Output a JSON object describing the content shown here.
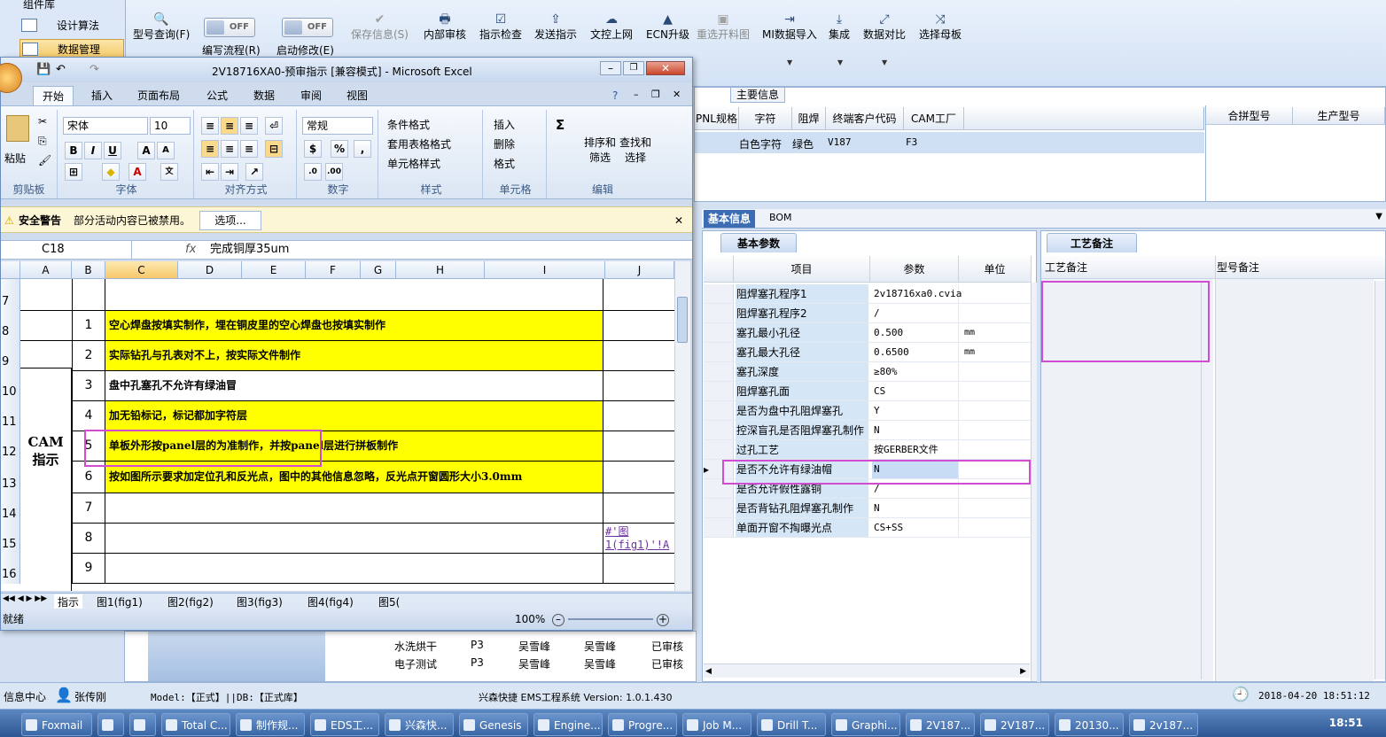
{
  "left_nav": {
    "top_label": "组件库",
    "items": [
      {
        "label": "设计算法"
      },
      {
        "label": "数据管理"
      }
    ]
  },
  "toolbar": {
    "tabs_hint": "EMS工程系统",
    "buttons": [
      {
        "label": "型号查询(F)",
        "glyph": "🔍"
      },
      {
        "label": "编写流程(R)",
        "toggle": "OFF"
      },
      {
        "label": "启动修改(E)",
        "toggle": "OFF"
      },
      {
        "label": "保存信息(S)",
        "glyph": "✔"
      },
      {
        "label": "内部审核",
        "glyph": "🖶"
      },
      {
        "label": "指示检查",
        "glyph": "☑"
      },
      {
        "label": "发送指示",
        "glyph": "⇪"
      },
      {
        "label": "文控上网",
        "glyph": "☁"
      },
      {
        "label": "ECN升级",
        "glyph": "▲"
      },
      {
        "label": "重选开料图",
        "glyph": "▣"
      },
      {
        "label": "MI数据导入",
        "glyph": "⇥"
      },
      {
        "label": "集成",
        "glyph": "⤓"
      },
      {
        "label": "数据对比",
        "glyph": "⤢"
      },
      {
        "label": "选择母板",
        "glyph": "⤨"
      }
    ]
  },
  "main_info": {
    "title": "主要信息",
    "headers": [
      "PNL规格",
      "字符",
      "阻焊",
      "终端客户代码",
      "CAM工厂"
    ],
    "headers_right": [
      "合拼型号",
      "生产型号"
    ],
    "row": [
      "白色字符",
      "绿色",
      "V187",
      "F3"
    ]
  },
  "detail_tabs": {
    "tab1": "基本信息",
    "tab2": "BOM"
  },
  "basic_panel": {
    "title": "基本参数",
    "headers": [
      "项目",
      "参数",
      "单位"
    ],
    "rows": [
      {
        "k": "阻焊塞孔程序1",
        "v": "2v18716xa0.cvia",
        "u": ""
      },
      {
        "k": "阻焊塞孔程序2",
        "v": "/",
        "u": ""
      },
      {
        "k": "塞孔最小孔径",
        "v": "0.500",
        "u": "mm"
      },
      {
        "k": "塞孔最大孔径",
        "v": "0.6500",
        "u": "mm"
      },
      {
        "k": "塞孔深度",
        "v": "≥80%",
        "u": ""
      },
      {
        "k": "阻焊塞孔面",
        "v": "CS",
        "u": ""
      },
      {
        "k": "是否为盘中孔阻焊塞孔",
        "v": "Y",
        "u": ""
      },
      {
        "k": "控深盲孔是否阻焊塞孔制作",
        "v": "N",
        "u": ""
      },
      {
        "k": "过孔工艺",
        "v": "按GERBER文件",
        "u": ""
      },
      {
        "k": "是否不允许有绿油帽",
        "v": "N",
        "u": ""
      },
      {
        "k": "是否允许假性露铜",
        "v": "/",
        "u": ""
      },
      {
        "k": "是否背钻孔阻焊塞孔制作",
        "v": "N",
        "u": ""
      },
      {
        "k": "单面开窗不掏曝光点",
        "v": "CS+SS",
        "u": ""
      }
    ]
  },
  "craft_panel": {
    "title": "工艺备注",
    "col1": "工艺备注",
    "col2": "型号备注"
  },
  "tree_rows": [
    {
      "name": "水洗烘干",
      "f": "P3",
      "a": "吴雪峰",
      "b": "吴雪峰",
      "s": "已审核"
    },
    {
      "name": "电子测试",
      "f": "P3",
      "a": "吴雪峰",
      "b": "吴雪峰",
      "s": "已审核"
    }
  ],
  "status": {
    "left": "信息中心",
    "user": "张传刚",
    "model": "Model:【正式】||DB:【正式库】",
    "system": "兴森快捷 EMS工程系统 Version: 1.0.1.430",
    "datetime": "2018-04-20 18:51:12"
  },
  "excel": {
    "title": "2V18716XA0-预审指示 [兼容模式] - Microsoft Excel",
    "tabs": [
      "开始",
      "插入",
      "页面布局",
      "公式",
      "数据",
      "审阅",
      "视图"
    ],
    "ribbon": {
      "paste": "粘贴",
      "clipboard": "剪贴板",
      "font": "宋体",
      "size": "10",
      "font_group": "字体",
      "align_group": "对齐方式",
      "numfmt": "常规",
      "number_group": "数字",
      "cond": "条件格式",
      "table": "套用表格格式",
      "cellstyle": "单元格样式",
      "style_group": "样式",
      "insert": "插入",
      "delete": "删除",
      "format": "格式",
      "cells_group": "单元格",
      "sort": "排序和筛选",
      "find": "查找和选择",
      "edit_group": "编辑"
    },
    "warning": {
      "label": "安全警告",
      "msg": "部分活动内容已被禁用。",
      "btn": "选项..."
    },
    "namebox": "C18",
    "formula": "完成铜厚35um",
    "columns": [
      "A",
      "B",
      "C",
      "D",
      "E",
      "F",
      "G",
      "H",
      "I",
      "J"
    ],
    "row_label": "CAM指示",
    "rows": [
      {
        "r": "7",
        "n": "",
        "t": "",
        "y": false
      },
      {
        "r": "8",
        "n": "1",
        "t": "空心焊盘按填实制作，埋在铜皮里的空心焊盘也按填实制作",
        "y": true
      },
      {
        "r": "9",
        "n": "2",
        "t": "实际钻孔与孔表对不上，按实际文件制作",
        "y": true
      },
      {
        "r": "10",
        "n": "3",
        "t": "盘中孔塞孔不允许有绿油冒",
        "y": false
      },
      {
        "r": "11",
        "n": "4",
        "t": "加无铅标记，标记都加字符层",
        "y": true
      },
      {
        "r": "12",
        "n": "5",
        "t": "单板外形按panel层的为准制作，并按panel层进行拼板制作",
        "y": true
      },
      {
        "r": "13",
        "n": "6",
        "t": "按如图所示要求加定位孔和反光点，图中的其他信息忽略，反光点开窗圆形大小3.0mm",
        "y": true
      },
      {
        "r": "14",
        "n": "7",
        "t": "",
        "y": false
      },
      {
        "r": "15",
        "n": "8",
        "t": "",
        "y": false
      },
      {
        "r": "16",
        "n": "9",
        "t": "",
        "y": false
      }
    ],
    "link_text": "#'图1(fig1)'!A",
    "sheets": [
      "指示",
      "图1(fig1)",
      "图2(fig2)",
      "图3(fig3)",
      "图4(fig4)",
      "图5("
    ],
    "statusbar": {
      "ready": "就绪",
      "zoom": "100%"
    }
  },
  "taskbar": {
    "items": [
      "Foxmail",
      "",
      "",
      "Total C...",
      "制作规...",
      "EDS工...",
      "兴森快...",
      "Genesis",
      "Engine...",
      "Progre...",
      "Job M...",
      "Drill T...",
      "Graphi...",
      "2V187...",
      "2V187...",
      "20130...",
      "2v187..."
    ],
    "clock": "18:51"
  }
}
